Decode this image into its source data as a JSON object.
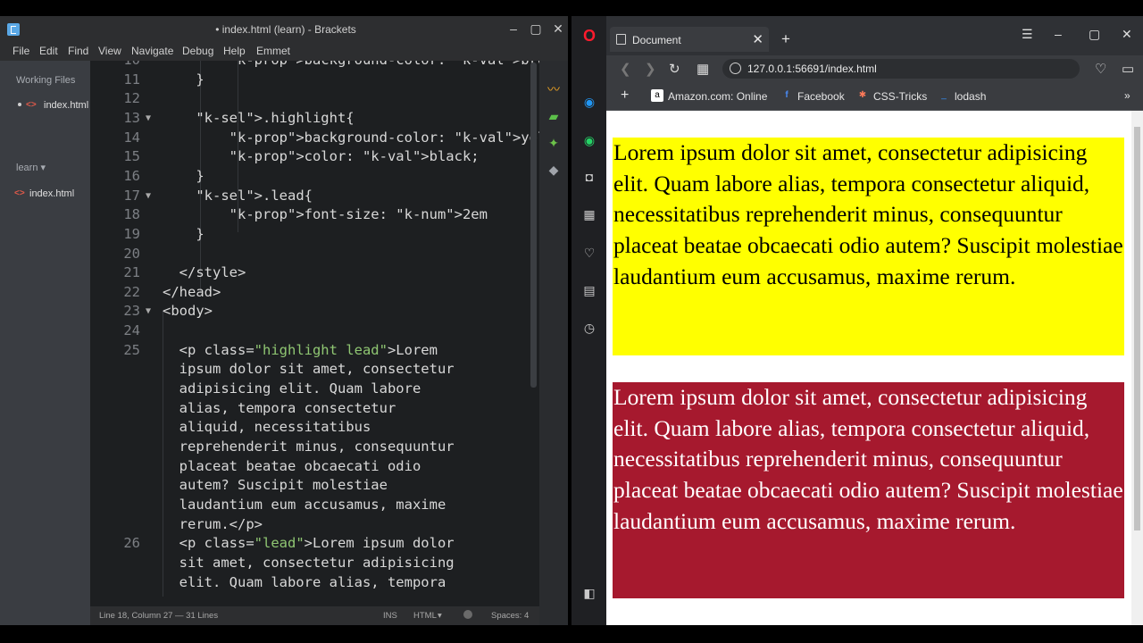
{
  "brackets": {
    "title": "• index.html (learn) - Brackets",
    "menu": [
      "File",
      "Edit",
      "Find",
      "View",
      "Navigate",
      "Debug",
      "Help",
      "Emmet"
    ],
    "sidebar": {
      "working_files_label": "Working Files",
      "working_file": {
        "tag": "<>",
        "name": "index.html"
      },
      "project_label": "learn ▾",
      "project_file": {
        "tag": "<>",
        "name": "index.html"
      }
    },
    "code_lines": [
      {
        "n": "10",
        "text": "        background-color: brown;"
      },
      {
        "n": "11",
        "text": "    }"
      },
      {
        "n": "12",
        "text": ""
      },
      {
        "n": "13",
        "text": "    .highlight{"
      },
      {
        "n": "14",
        "text": "        background-color: yellow;"
      },
      {
        "n": "15",
        "text": "        color: black;"
      },
      {
        "n": "16",
        "text": "    }"
      },
      {
        "n": "17",
        "text": "    .lead{"
      },
      {
        "n": "18",
        "text": "        font-size: 2em"
      },
      {
        "n": "19",
        "text": "    }"
      },
      {
        "n": "20",
        "text": ""
      },
      {
        "n": "21",
        "text": "  </style>"
      },
      {
        "n": "22",
        "text": "</head>"
      },
      {
        "n": "23",
        "text": "<body>"
      },
      {
        "n": "24",
        "text": ""
      },
      {
        "n": "25",
        "text": "  <p class=\"highlight lead\">Lorem"
      },
      {
        "n": "",
        "text": "  ipsum dolor sit amet, consectetur"
      },
      {
        "n": "",
        "text": "  adipisicing elit. Quam labore"
      },
      {
        "n": "",
        "text": "  alias, tempora consectetur"
      },
      {
        "n": "",
        "text": "  aliquid, necessitatibus"
      },
      {
        "n": "",
        "text": "  reprehenderit minus, consequuntur"
      },
      {
        "n": "",
        "text": "  placeat beatae obcaecati odio"
      },
      {
        "n": "",
        "text": "  autem? Suscipit molestiae"
      },
      {
        "n": "",
        "text": "  laudantium eum accusamus, maxime"
      },
      {
        "n": "",
        "text": "  rerum.</p>"
      },
      {
        "n": "26",
        "text": "  <p class=\"lead\">Lorem ipsum dolor"
      },
      {
        "n": "",
        "text": "  sit amet, consectetur adipisicing"
      },
      {
        "n": "",
        "text": "  elit. Quam labore alias, tempora"
      }
    ],
    "status": {
      "position": "Line 18, Column 27 — 31 Lines",
      "mode": "INS",
      "language": "HTML",
      "language_arrow": "▾",
      "spaces": "Spaces: 4"
    }
  },
  "opera": {
    "tab_title": "Document",
    "url": "127.0.0.1:56691/index.html",
    "bookmarks": [
      {
        "label": "Amazon.com: Online",
        "icon": "amazon-icon"
      },
      {
        "label": "Facebook",
        "icon": "facebook-icon"
      },
      {
        "label": "CSS-Tricks",
        "icon": "css-tricks-icon"
      },
      {
        "label": "lodash",
        "icon": "lodash-icon"
      }
    ],
    "paragraph1": "Lorem ipsum dolor sit amet, consectetur adipisicing elit. Quam labore alias, tempora consectetur aliquid, necessitatibus reprehenderit minus, consequuntur placeat beatae obcaecati odio autem? Suscipit molestiae laudantium eum accusamus, maxime rerum.",
    "paragraph2": "Lorem ipsum dolor sit amet, consectetur adipisicing elit. Quam labore alias, tempora consectetur aliquid, necessitatibus reprehenderit minus, consequuntur placeat beatae obcaecati odio autem? Suscipit molestiae laudantium eum accusamus, maxime rerum."
  },
  "colors": {
    "highlight_bg": "#ffff00",
    "lead_bg": "#a6192e",
    "editor_bg": "#1d1f21"
  }
}
